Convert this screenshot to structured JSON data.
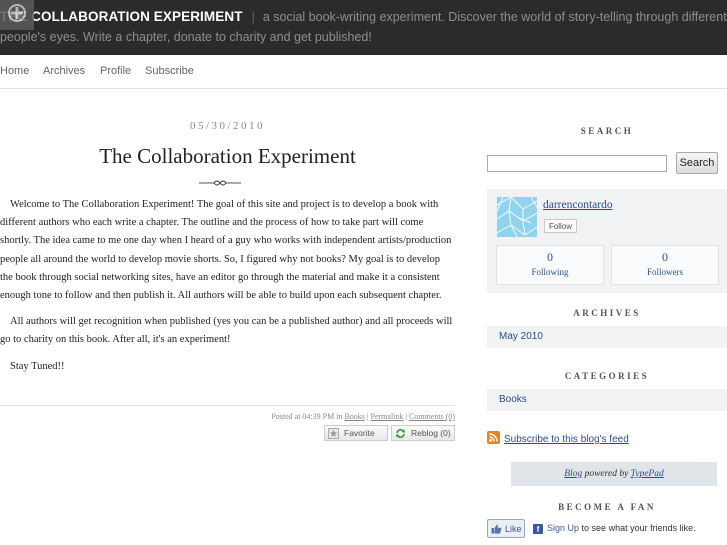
{
  "header": {
    "title": "THE COLLABORATION EXPERIMENT",
    "tagline_line1": "a social book-writing experiment. Discover the world of story-telling through different",
    "tagline_line2": "people's eyes. Write a chapter, donate to charity and get published!"
  },
  "nav": {
    "items": [
      "Home",
      "Archives",
      "Profile",
      "Subscribe"
    ]
  },
  "post": {
    "date": "05/30/2010",
    "title": "The Collaboration Experiment",
    "paragraphs": [
      "Welcome to The Collaboration Experiment! The goal of this site and project is to develop a book with different authors who each write a chapter. The outline and the process of how to take part will come shortly. The idea came to me one day when I heard of a guy who works with independent artists/production people all around the world to develop movie shorts. So, I figured why not books? My goal is to develop the book through social networking sites, have an editor go through the material and make it a consistent enough tone to follow and then publish it. All authors will be able to build upon each subsequent chapter.",
      "All authors will get recognition when published (yes you can be a published author) and all proceeds will go to charity on this book. After all, it's an experiment!",
      "Stay Tuned!!"
    ],
    "footer": {
      "posted_at": "Posted at 04:39 PM in",
      "category": "Books",
      "permalink": "Permalink",
      "comments": "Comments (0)"
    },
    "favorite_label": "Favorite",
    "reblog_label": "Reblog (0)"
  },
  "sidebar": {
    "search_heading": "SEARCH",
    "search_button": "Search",
    "search_value": "",
    "profile": {
      "name": "darrencontardo",
      "follow_label": "Follow",
      "following_count": "0",
      "following_label": "Following",
      "followers_count": "0",
      "followers_label": "Followers"
    },
    "archives_heading": "ARCHIVES",
    "archives_item": "May 2010",
    "categories_heading": "CATEGORIES",
    "categories_item": "Books",
    "subscribe_link": "Subscribe to this blog's feed",
    "typepad": {
      "blog": "Blog",
      "powered_by": "powered by",
      "typepad": "TypePad"
    },
    "become_fan_heading": "BECOME A FAN",
    "like_label": "Like",
    "fb_signup": "Sign Up",
    "fb_text": "to see what your friends like."
  },
  "colors": {
    "header_bg": "#2b2b2b",
    "link_blue": "#2a4f8a",
    "panel_bg": "#f0f2f4",
    "facebook_blue": "#3b5998",
    "rss_orange": "#e8822a"
  }
}
